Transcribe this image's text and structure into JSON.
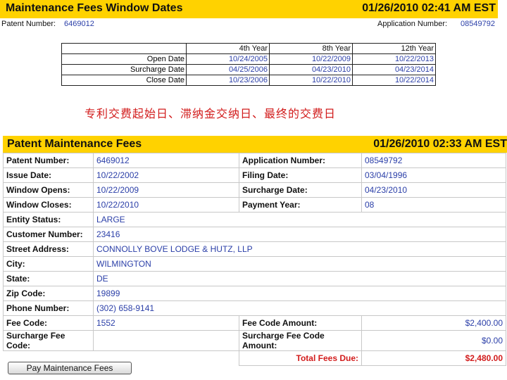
{
  "window_dates": {
    "title": "Maintenance Fees Window Dates",
    "timestamp": "01/26/2010 02:41 AM EST",
    "patent_number_label": "Patent Number:",
    "patent_number": "6469012",
    "application_number_label": "Application Number:",
    "application_number": "08549792",
    "columns": [
      "4th Year",
      "8th Year",
      "12th Year"
    ],
    "rows": [
      {
        "label": "Open Date",
        "values": [
          "10/24/2005",
          "10/22/2009",
          "10/22/2013"
        ]
      },
      {
        "label": "Surcharge Date",
        "values": [
          "04/25/2006",
          "04/23/2010",
          "04/23/2014"
        ]
      },
      {
        "label": "Close Date",
        "values": [
          "10/23/2006",
          "10/22/2010",
          "10/22/2014"
        ]
      }
    ]
  },
  "note_cn": "专利交费起始日、滞纳金交纳日、最终的交费日",
  "fees": {
    "title": "Patent Maintenance Fees",
    "timestamp": "01/26/2010 02:33 AM EST",
    "patent_number_label": "Patent Number:",
    "patent_number": "6469012",
    "application_number_label": "Application Number:",
    "application_number": "08549792",
    "issue_date_label": "Issue Date:",
    "issue_date": "10/22/2002",
    "filing_date_label": "Filing Date:",
    "filing_date": "03/04/1996",
    "window_opens_label": "Window Opens:",
    "window_opens": "10/22/2009",
    "surcharge_date_label": "Surcharge Date:",
    "surcharge_date": "04/23/2010",
    "window_closes_label": "Window Closes:",
    "window_closes": "10/22/2010",
    "payment_year_label": "Payment Year:",
    "payment_year": "08",
    "entity_status_label": "Entity Status:",
    "entity_status": "LARGE",
    "customer_number_label": "Customer Number:",
    "customer_number": "23416",
    "street_address_label": "Street Address:",
    "street_address": "CONNOLLY BOVE LODGE & HUTZ, LLP",
    "city_label": "City:",
    "city": "WILMINGTON",
    "state_label": "State:",
    "state": "DE",
    "zip_label": "Zip Code:",
    "zip": "19899",
    "phone_label": "Phone Number:",
    "phone": "(302) 658-9141",
    "fee_code_label": "Fee Code:",
    "fee_code": "1552",
    "fee_code_amount_label": "Fee Code Amount:",
    "fee_code_amount": "$2,400.00",
    "surcharge_fee_code_label": "Surcharge Fee Code:",
    "surcharge_fee_code": "",
    "surcharge_fee_code_amount_label": "Surcharge Fee Code Amount:",
    "surcharge_fee_code_amount": "$0.00",
    "total_fees_due_label": "Total Fees Due:",
    "total_fees_due": "$2,480.00"
  },
  "pay_button_label": "Pay Maintenance Fees",
  "colors": {
    "header_bar": "#ffd200",
    "value_text": "#2b3fa8",
    "note_text": "#d21c1c"
  }
}
